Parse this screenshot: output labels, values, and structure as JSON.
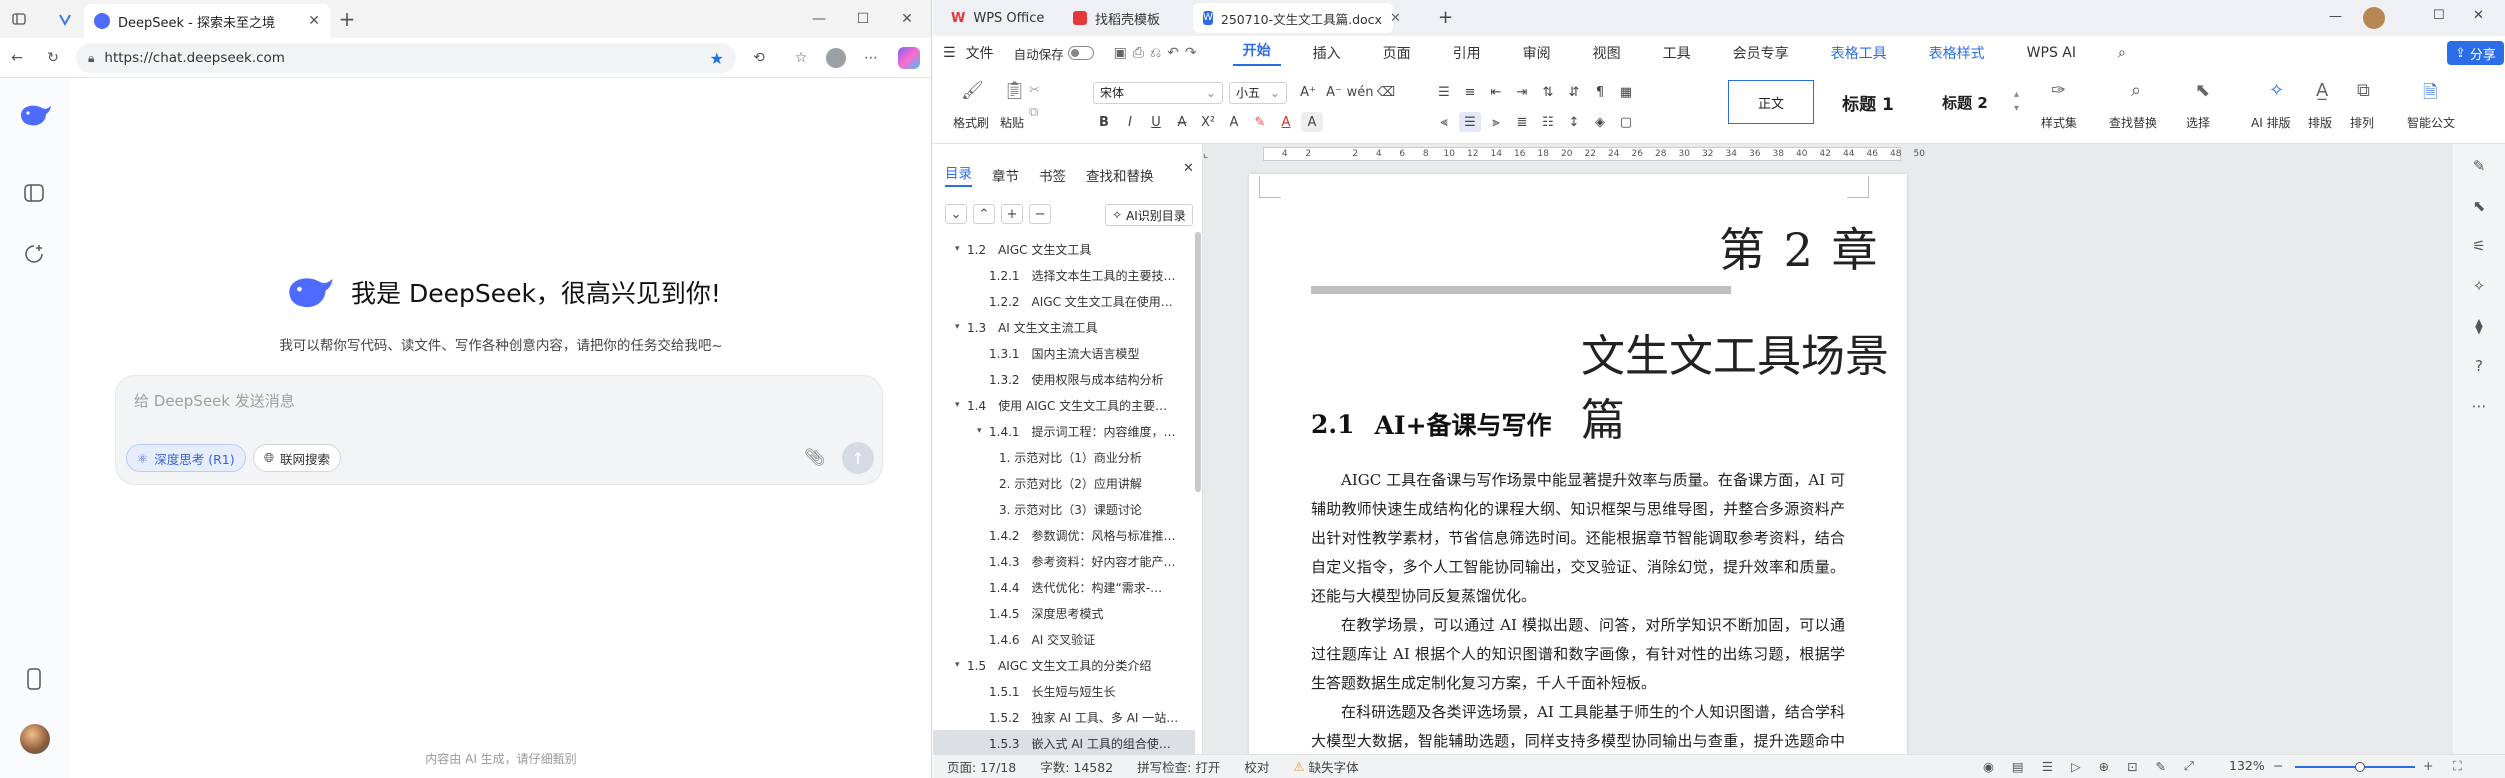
{
  "browser": {
    "tab_title": "DeepSeek - 探索未至之境",
    "url": "https://chat.deepseek.com",
    "hello": "我是 DeepSeek，很高兴见到你!",
    "subtitle": "我可以帮你写代码、读文件、写作各种创意内容，请把你的任务交给我吧~",
    "input_placeholder": "给 DeepSeek 发送消息",
    "deep_think_label": "深度思考 (R1)",
    "web_search_label": "联网搜索",
    "footer": "内容由 AI 生成，请仔细甄别",
    "colors": {
      "accent": "#4d6bfe"
    }
  },
  "wps": {
    "tabs": [
      "WPS Office",
      "找稻壳模板",
      "250710-文生文工具篇.docx"
    ],
    "menu": {
      "file": "文件",
      "autosave": "自动保存",
      "items": [
        "开始",
        "插入",
        "页面",
        "引用",
        "审阅",
        "视图",
        "工具",
        "会员专享",
        "表格工具",
        "表格样式",
        "WPS AI"
      ],
      "active": "开始",
      "share": "分享"
    },
    "ribbon": {
      "format_painter": "格式刷",
      "paste": "粘贴",
      "font_name": "宋体",
      "font_size": "小五",
      "styles": [
        "正文",
        "标题 1",
        "标题 2"
      ],
      "style_set": "样式集",
      "find_replace": "查找替换",
      "select": "选择",
      "ai_layout": "AI 排版",
      "layout": "排版",
      "arrange": "排列",
      "smart_doc": "智能公文"
    },
    "nav": {
      "tabs": [
        "目录",
        "章节",
        "书签",
        "查找和替换"
      ],
      "ai_toc": "AI识别目录",
      "items": [
        {
          "level": 2,
          "text": "1.2　AIGC 文生文工具",
          "expand": true
        },
        {
          "level": 3,
          "text": "1.2.1　选择文本生工具的主要技…"
        },
        {
          "level": 3,
          "text": "1.2.2　AIGC 文生文工具在使用…"
        },
        {
          "level": 2,
          "text": "1.3　AI 文生文主流工具",
          "expand": true
        },
        {
          "level": 3,
          "text": "1.3.1　国内主流大语言模型"
        },
        {
          "level": 3,
          "text": "1.3.2　使用权限与成本结构分析"
        },
        {
          "level": 2,
          "text": "1.4　使用 AIGC 文生文工具的主要…",
          "expand": true
        },
        {
          "level": 3,
          "text": "1.4.1　提示词工程：内容维度，…",
          "expand": true
        },
        {
          "level": 4,
          "text": "1. 示范对比（1）商业分析"
        },
        {
          "level": 4,
          "text": "2. 示范对比（2）应用讲解"
        },
        {
          "level": 4,
          "text": "3. 示范对比（3）课题讨论"
        },
        {
          "level": 3,
          "text": "1.4.2　参数调优：风格与标准推…"
        },
        {
          "level": 3,
          "text": "1.4.3　参考资料：好内容才能产…"
        },
        {
          "level": 3,
          "text": "1.4.4　迭代优化：构建“需求-…"
        },
        {
          "level": 3,
          "text": "1.4.5　深度思考模式"
        },
        {
          "level": 3,
          "text": "1.4.6　AI 交叉验证"
        },
        {
          "level": 2,
          "text": "1.5　AIGC 文生文工具的分类介绍",
          "expand": true
        },
        {
          "level": 3,
          "text": "1.5.1　长生短与短生长"
        },
        {
          "level": 3,
          "text": "1.5.2　独家 AI 工具、多 AI 一站…"
        },
        {
          "level": 3,
          "text": "1.5.3　嵌入式 AI 工具的组合使…",
          "selected": true
        }
      ]
    },
    "ruler_ticks": [
      "4",
      "2",
      "",
      "2",
      "4",
      "6",
      "8",
      "10",
      "12",
      "14",
      "16",
      "18",
      "20",
      "22",
      "24",
      "26",
      "28",
      "30",
      "32",
      "34",
      "36",
      "38",
      "40",
      "42",
      "44",
      "46",
      "48",
      "50"
    ],
    "doc": {
      "chapter": "第 2 章",
      "chapter_title": "文生文工具场景篇",
      "section_num": "2.1",
      "section_title": "AI+备课与写作",
      "paragraphs": [
        "AIGC 工具在备课与写作场景中能显著提升效率与质量。在备课方面，AI 可辅助教师快速生成结构化的课程大纲、知识框架与思维导图，并整合多源资料产出针对性教学素材，节省信息筛选时间。还能根据章节智能调取参考资料，结合自定义指令，多个人工智能协同输出，交叉验证、消除幻觉，提升效率和质量。还能与大模型协同反复蒸馏优化。",
        "在教学场景，可以通过 AI 模拟出题、问答，对所学知识不断加固，可以通过往题库让 AI 根据个人的知识图谱和数字画像，有针对性的出练习题，根据学生答题数据生成定制化复习方案，千人千面补短板。",
        "在科研选题及各类评选场景，AI 工具能基于师生的个人知识图谱，结合学科大模型大数据，智能辅助选题，同样支持多模型协同输出与查重，提升选题命中率与申报通过率。"
      ]
    },
    "status": {
      "page": "页面: 17/18",
      "words": "字数: 14582",
      "spell": "拼写检查: 打开",
      "proof": "校对",
      "missing_font": "缺失字体",
      "zoom": "132%"
    }
  }
}
